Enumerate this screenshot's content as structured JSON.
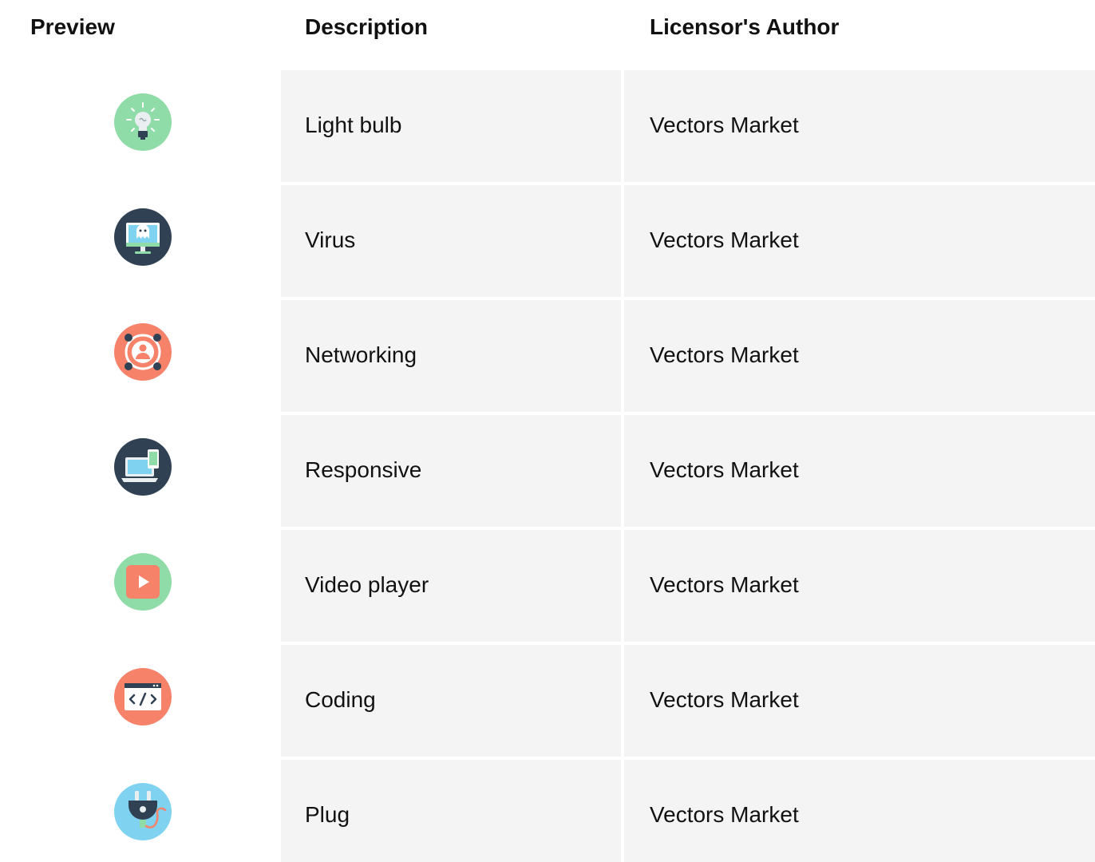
{
  "table": {
    "headers": {
      "preview": "Preview",
      "description": "Description",
      "author": "Licensor's Author"
    },
    "rows": [
      {
        "icon": "light-bulb-icon",
        "description": "Light bulb",
        "author": "Vectors Market"
      },
      {
        "icon": "virus-icon",
        "description": "Virus",
        "author": "Vectors Market"
      },
      {
        "icon": "networking-icon",
        "description": "Networking",
        "author": "Vectors Market"
      },
      {
        "icon": "responsive-icon",
        "description": "Responsive",
        "author": "Vectors Market"
      },
      {
        "icon": "video-player-icon",
        "description": "Video player",
        "author": "Vectors Market"
      },
      {
        "icon": "coding-icon",
        "description": "Coding",
        "author": "Vectors Market"
      },
      {
        "icon": "plug-icon",
        "description": "Plug",
        "author": "Vectors Market"
      }
    ]
  },
  "colors": {
    "cell_background": "#f4f4f4",
    "text": "#111111",
    "mint": "#8fdca8",
    "navy": "#2f4152",
    "coral": "#f6826a",
    "sky": "#7fd3f0"
  }
}
